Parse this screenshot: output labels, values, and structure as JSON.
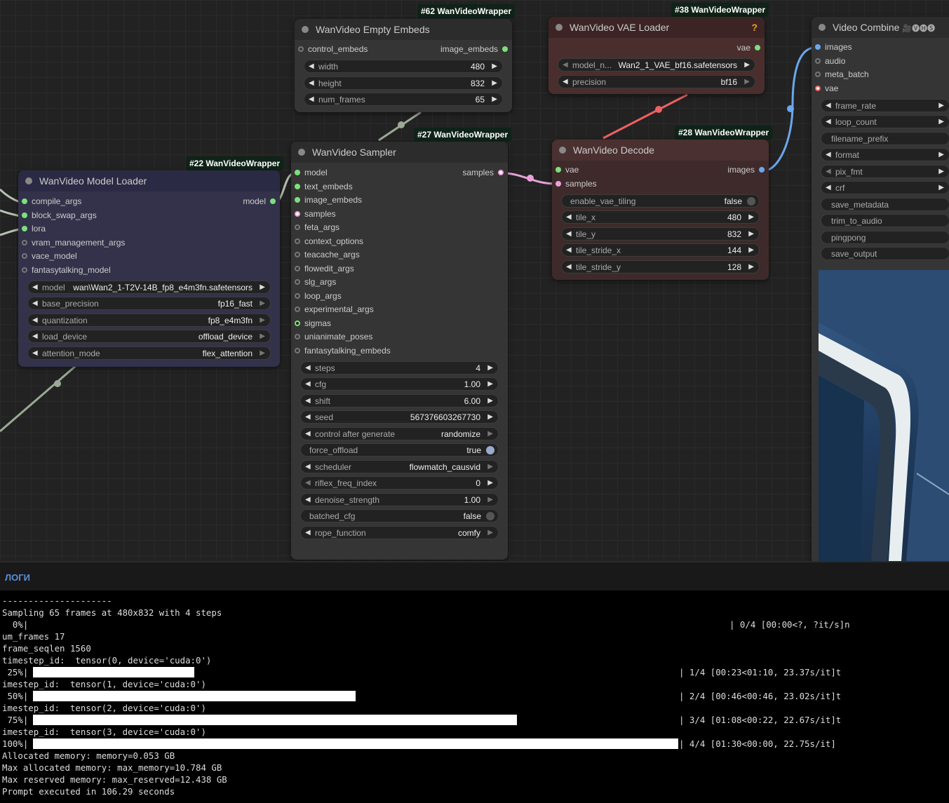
{
  "nodes": {
    "model_loader": {
      "badge": "#22 WanVideoWrapper",
      "title": "WanVideo Model Loader",
      "inputs": [
        "compile_args",
        "block_swap_args",
        "lora",
        "vram_management_args",
        "vace_model",
        "fantasytalking_model"
      ],
      "output": "model",
      "widgets": [
        {
          "name": "model",
          "value": "wan\\Wan2_1-T2V-14B_fp8_e4m3fn.safetensors"
        },
        {
          "name": "base_precision",
          "value": "fp16_fast"
        },
        {
          "name": "quantization",
          "value": "fp8_e4m3fn"
        },
        {
          "name": "load_device",
          "value": "offload_device"
        },
        {
          "name": "attention_mode",
          "value": "flex_attention"
        }
      ]
    },
    "empty_embeds": {
      "badge": "#62 WanVideoWrapper",
      "title": "WanVideo Empty Embeds",
      "input": "control_embeds",
      "output": "image_embeds",
      "widgets": [
        {
          "name": "width",
          "value": "480"
        },
        {
          "name": "height",
          "value": "832"
        },
        {
          "name": "num_frames",
          "value": "65"
        }
      ]
    },
    "sampler": {
      "badge": "#27 WanVideoWrapper",
      "title": "WanVideo Sampler",
      "inputs": [
        "model",
        "text_embeds",
        "image_embeds",
        "samples",
        "feta_args",
        "context_options",
        "teacache_args",
        "flowedit_args",
        "slg_args",
        "loop_args",
        "experimental_args",
        "sigmas",
        "unianimate_poses",
        "fantasytalking_embeds"
      ],
      "output": "samples",
      "widgets": [
        {
          "name": "steps",
          "value": "4"
        },
        {
          "name": "cfg",
          "value": "1.00"
        },
        {
          "name": "shift",
          "value": "6.00"
        },
        {
          "name": "seed",
          "value": "567376603267730"
        },
        {
          "name": "control after generate",
          "value": "randomize"
        },
        {
          "name": "force_offload",
          "value": "true"
        },
        {
          "name": "scheduler",
          "value": "flowmatch_causvid"
        },
        {
          "name": "riflex_freq_index",
          "value": "0"
        },
        {
          "name": "denoise_strength",
          "value": "1.00"
        },
        {
          "name": "batched_cfg",
          "value": "false"
        },
        {
          "name": "rope_function",
          "value": "comfy"
        }
      ]
    },
    "vae_loader": {
      "badge": "#38 WanVideoWrapper",
      "title": "WanVideo VAE Loader",
      "help": "?",
      "output": "vae",
      "widgets": [
        {
          "name": "model_n...",
          "value": "Wan2_1_VAE_bf16.safetensors"
        },
        {
          "name": "precision",
          "value": "bf16"
        }
      ]
    },
    "decode": {
      "badge": "#28 WanVideoWrapper",
      "title": "WanVideo Decode",
      "inputs": [
        "vae",
        "samples"
      ],
      "output": "images",
      "widgets": [
        {
          "name": "enable_vae_tiling",
          "value": "false"
        },
        {
          "name": "tile_x",
          "value": "480"
        },
        {
          "name": "tile_y",
          "value": "832"
        },
        {
          "name": "tile_stride_x",
          "value": "144"
        },
        {
          "name": "tile_stride_y",
          "value": "128"
        }
      ]
    },
    "video_combine": {
      "title": "Video Combine",
      "tag": "🎥🅥🅗🅢",
      "inputs": [
        "images",
        "audio",
        "meta_batch",
        "vae"
      ],
      "widgets": [
        "frame_rate",
        "loop_count",
        "filename_prefix",
        "format",
        "pix_fmt",
        "crf",
        "save_metadata",
        "trim_to_audio",
        "pingpong",
        "save_output"
      ]
    }
  },
  "logs": {
    "title": "ЛОГИ",
    "lines": [
      "---------------------",
      "Sampling 65 frames at 480x832 with 4 steps",
      "  0%|",
      "um_frames 17",
      "frame_seqlen 1560",
      "timestep_id:  tensor(0, device='cuda:0')",
      " 25%|",
      "imestep_id:  tensor(1, device='cuda:0')",
      " 50%|",
      "imestep_id:  tensor(2, device='cuda:0')",
      " 75%|",
      "imestep_id:  tensor(3, device='cuda:0')",
      "100%|",
      "Allocated memory: memory=0.053 GB",
      "Max allocated memory: max_memory=10.784 GB",
      "Max reserved memory: max_reserved=12.438 GB",
      "Prompt executed in 106.29 seconds"
    ],
    "progress": [
      {
        "fraction": 0.0,
        "tail": "| 0/4 [00:00<?, ?it/s]n"
      },
      {
        "fraction": 0.25,
        "tail": "| 1/4 [00:23<01:10, 23.37s/it]t"
      },
      {
        "fraction": 0.5,
        "tail": "| 2/4 [00:46<00:46, 23.02s/it]t"
      },
      {
        "fraction": 0.75,
        "tail": "| 3/4 [01:08<00:22, 22.67s/it]t"
      },
      {
        "fraction": 1.0,
        "tail": "| 4/4 [01:30<00:00, 22.75s/it]"
      }
    ]
  },
  "colors": {
    "model": "#b7b7b7",
    "vae": "#f06060",
    "samples": "#e8a0d8",
    "images": "#6aa7f0"
  }
}
